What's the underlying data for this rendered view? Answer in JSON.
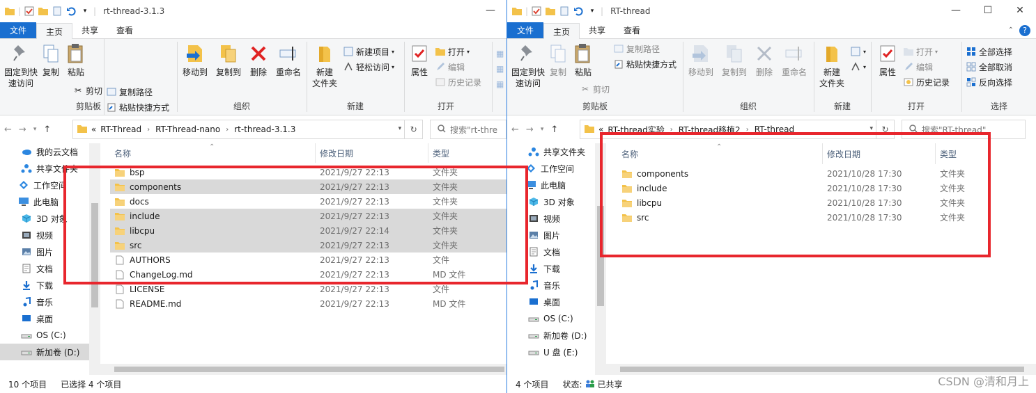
{
  "left": {
    "title": "rt-thread-3.1.3",
    "tabs": [
      "文件",
      "主页",
      "共享",
      "查看"
    ],
    "ribbon": {
      "clipboard": {
        "pin": "固定到快\n速访问",
        "copy": "复制",
        "paste": "粘贴",
        "copy_path": "复制路径",
        "paste_shortcut": "粘贴快捷方式",
        "cut": "剪切",
        "label": "剪贴板"
      },
      "organize": {
        "move_to": "移动到",
        "copy_to": "复制到",
        "delete": "删除",
        "rename": "重命名",
        "label": "组织"
      },
      "new": {
        "new_folder": "新建\n文件夹",
        "new_item": "新建项目",
        "easy_access": "轻松访问",
        "label": "新建"
      },
      "open": {
        "properties": "属性",
        "open": "打开",
        "edit": "编辑",
        "history": "历史记录",
        "label": "打开"
      }
    },
    "breadcrumb": [
      "RT-Thread",
      "RT-Thread-nano",
      "rt-thread-3.1.3"
    ],
    "breadcrumb_prefix": "«",
    "search_placeholder": "搜索\"rt-thre",
    "nav": [
      {
        "label": "我的云文档",
        "icon": "cloud-icon"
      },
      {
        "label": "共享文件夹",
        "icon": "share-icon"
      },
      {
        "label": "工作空间",
        "icon": "workspace-icon"
      },
      {
        "label": "此电脑",
        "icon": "computer-icon"
      },
      {
        "label": "3D 对象",
        "icon": "cube-icon"
      },
      {
        "label": "视频",
        "icon": "video-icon"
      },
      {
        "label": "图片",
        "icon": "picture-icon"
      },
      {
        "label": "文档",
        "icon": "document-icon"
      },
      {
        "label": "下载",
        "icon": "download-icon"
      },
      {
        "label": "音乐",
        "icon": "music-icon"
      },
      {
        "label": "桌面",
        "icon": "desktop-icon"
      },
      {
        "label": "OS (C:)",
        "icon": "drive-icon"
      },
      {
        "label": "新加卷 (D:)",
        "icon": "drive-icon"
      }
    ],
    "columns": {
      "name": "名称",
      "date": "修改日期",
      "type": "类型"
    },
    "files": [
      {
        "name": "bsp",
        "date": "2021/9/27 22:13",
        "type": "文件夹",
        "kind": "folder",
        "selected": false
      },
      {
        "name": "components",
        "date": "2021/9/27 22:13",
        "type": "文件夹",
        "kind": "folder",
        "selected": true
      },
      {
        "name": "docs",
        "date": "2021/9/27 22:13",
        "type": "文件夹",
        "kind": "folder",
        "selected": false
      },
      {
        "name": "include",
        "date": "2021/9/27 22:13",
        "type": "文件夹",
        "kind": "folder",
        "selected": true
      },
      {
        "name": "libcpu",
        "date": "2021/9/27 22:14",
        "type": "文件夹",
        "kind": "folder",
        "selected": true
      },
      {
        "name": "src",
        "date": "2021/9/27 22:13",
        "type": "文件夹",
        "kind": "folder",
        "selected": true
      },
      {
        "name": "AUTHORS",
        "date": "2021/9/27 22:13",
        "type": "文件",
        "kind": "file",
        "selected": false
      },
      {
        "name": "ChangeLog.md",
        "date": "2021/9/27 22:13",
        "type": "MD 文件",
        "kind": "file",
        "selected": false
      },
      {
        "name": "LICENSE",
        "date": "2021/9/27 22:13",
        "type": "文件",
        "kind": "file",
        "selected": false
      },
      {
        "name": "README.md",
        "date": "2021/9/27 22:13",
        "type": "MD 文件",
        "kind": "file",
        "selected": false
      }
    ],
    "status": {
      "count": "10 个项目",
      "selected": "已选择 4 个项目"
    }
  },
  "right": {
    "title": "RT-thread",
    "tabs": [
      "文件",
      "主页",
      "共享",
      "查看"
    ],
    "ribbon": {
      "clipboard": {
        "pin": "固定到快\n速访问",
        "copy": "复制",
        "paste": "粘贴",
        "copy_path": "复制路径",
        "paste_shortcut": "粘贴快捷方式",
        "cut": "剪切",
        "label": "剪贴板"
      },
      "organize": {
        "move_to": "移动到",
        "copy_to": "复制到",
        "delete": "删除",
        "rename": "重命名",
        "label": "组织"
      },
      "new": {
        "new_folder": "新建\n文件夹",
        "label": "新建"
      },
      "open": {
        "properties": "属性",
        "open": "打开",
        "edit": "编辑",
        "history": "历史记录",
        "label": "打开"
      },
      "select": {
        "select_all": "全部选择",
        "select_none": "全部取消",
        "invert": "反向选择",
        "label": "选择"
      }
    },
    "breadcrumb": [
      "RT-thread实验",
      "RT-thread移植2",
      "RT-thread"
    ],
    "breadcrumb_prefix": "«",
    "search_placeholder": "搜索\"RT-thread\"",
    "nav": [
      {
        "label": "共享文件夹",
        "icon": "share-icon"
      },
      {
        "label": "工作空间",
        "icon": "workspace-icon"
      },
      {
        "label": "此电脑",
        "icon": "computer-icon"
      },
      {
        "label": "3D 对象",
        "icon": "cube-icon"
      },
      {
        "label": "视频",
        "icon": "video-icon"
      },
      {
        "label": "图片",
        "icon": "picture-icon"
      },
      {
        "label": "文档",
        "icon": "document-icon"
      },
      {
        "label": "下载",
        "icon": "download-icon"
      },
      {
        "label": "音乐",
        "icon": "music-icon"
      },
      {
        "label": "桌面",
        "icon": "desktop-icon"
      },
      {
        "label": "OS (C:)",
        "icon": "drive-icon"
      },
      {
        "label": "新加卷 (D:)",
        "icon": "drive-icon"
      },
      {
        "label": "U 盘 (E:)",
        "icon": "drive-icon"
      }
    ],
    "columns": {
      "name": "名称",
      "date": "修改日期",
      "type": "类型"
    },
    "files": [
      {
        "name": "components",
        "date": "2021/10/28 17:30",
        "type": "文件夹",
        "kind": "folder",
        "selected": false
      },
      {
        "name": "include",
        "date": "2021/10/28 17:30",
        "type": "文件夹",
        "kind": "folder",
        "selected": false
      },
      {
        "name": "libcpu",
        "date": "2021/10/28 17:30",
        "type": "文件夹",
        "kind": "folder",
        "selected": false
      },
      {
        "name": "src",
        "date": "2021/10/28 17:30",
        "type": "文件夹",
        "kind": "folder",
        "selected": false
      }
    ],
    "status": {
      "count": "4 个项目",
      "state": "状态:",
      "shared": "已共享"
    }
  },
  "watermark": "CSDN @清和月上",
  "colors": {
    "accent": "#1a6fd0",
    "highlight": "#e8262d",
    "folder": "#f3c24a",
    "selection": "#d9d9d9"
  }
}
